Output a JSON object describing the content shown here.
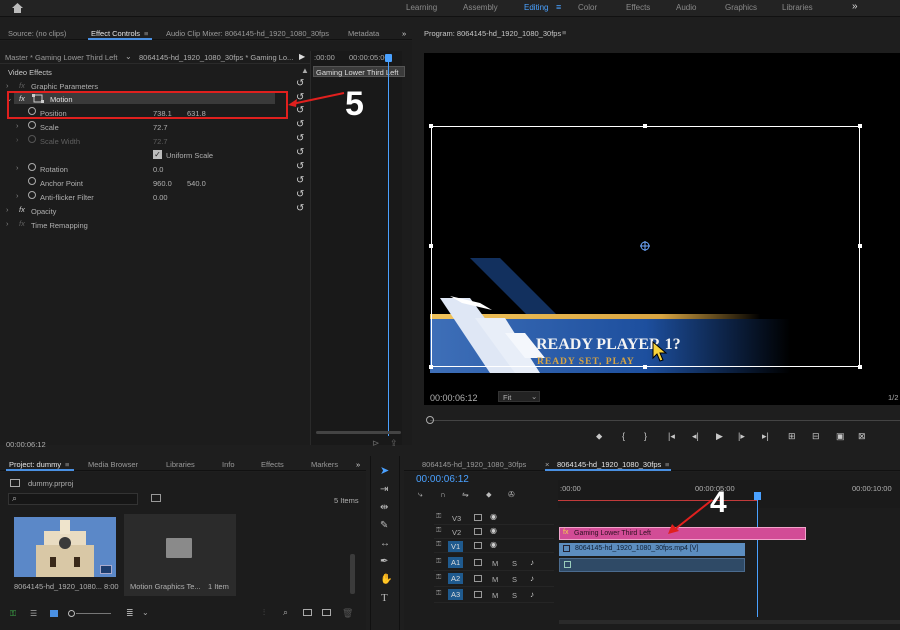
{
  "topbar": {
    "workspaces": [
      "Learning",
      "Assembly",
      "Editing",
      "Color",
      "Effects",
      "Audio",
      "Graphics",
      "Libraries"
    ],
    "active": "Editing",
    "more": "»"
  },
  "source_panel": {
    "tabs": [
      "Source: (no clips)",
      "Effect Controls",
      "Audio Clip Mixer: 8064145-hd_1920_1080_30fps",
      "Metadata"
    ],
    "menu": "≡",
    "more": "»"
  },
  "effect_controls": {
    "master_label": "Master * Gaming Lower Third Left",
    "sequence_label": "8064145-hd_1920_1080_30fps * Gaming Lo...",
    "time_start": ":00:00",
    "time_end": "00:00:05:00",
    "clip_label": "Gaming Lower Third Left",
    "video_effects": "Video Effects",
    "rows": {
      "graphic_parameters": "Graphic Parameters",
      "motion": "Motion",
      "position": "Position",
      "position_x": "738.1",
      "position_y": "631.8",
      "scale": "Scale",
      "scale_value": "72.7",
      "scale_width": "Scale Width",
      "scale_width_value": "72.7",
      "uniform_scale": "Uniform Scale",
      "rotation": "Rotation",
      "rotation_value": "0.0",
      "anchor_point": "Anchor Point",
      "anchor_x": "960.0",
      "anchor_y": "540.0",
      "anti_flicker": "Anti-flicker Filter",
      "anti_flicker_value": "0.00",
      "opacity": "Opacity",
      "time_remapping": "Time Remapping"
    },
    "timecode": "00:00:06:12"
  },
  "annotations": {
    "five": "5",
    "four": "4"
  },
  "program": {
    "title": "Program: 8064145-hd_1920_1080_30fps",
    "menu": "≡",
    "timecode": "00:00:06:12",
    "fit": "Fit",
    "fraction": "1/2",
    "graphic_title": "READY PLAYER 1?",
    "graphic_subtitle": "READY SET, PLAY"
  },
  "project": {
    "tabs": [
      "Project: dummy",
      "Media Browser",
      "Libraries",
      "Info",
      "Effects",
      "Markers"
    ],
    "menu": "≡",
    "more": "»",
    "file": "dummy.prproj",
    "items_count": "5 Items",
    "thumb1_name": "8064145-hd_1920_1080...",
    "thumb1_duration": "8:00",
    "thumb2_name": "Motion Graphics Te...",
    "thumb2_count": "1 Item"
  },
  "timeline": {
    "tabs": [
      "8064145-hd_1920_1080_30fps",
      "8064145-hd_1920_1080_30fps"
    ],
    "tab_menu": "≡",
    "close": "×",
    "timecode": "00:00:06:12",
    "ruler": [
      ":00:00",
      "00:00:05:00",
      "00:00:10:00"
    ],
    "tracks": [
      "V3",
      "V2",
      "V1",
      "A1",
      "A2",
      "A3"
    ],
    "clip_graphic": "Gaming Lower Third Left",
    "clip_video": "8064145-hd_1920_1080_30fps.mp4 [V]"
  }
}
